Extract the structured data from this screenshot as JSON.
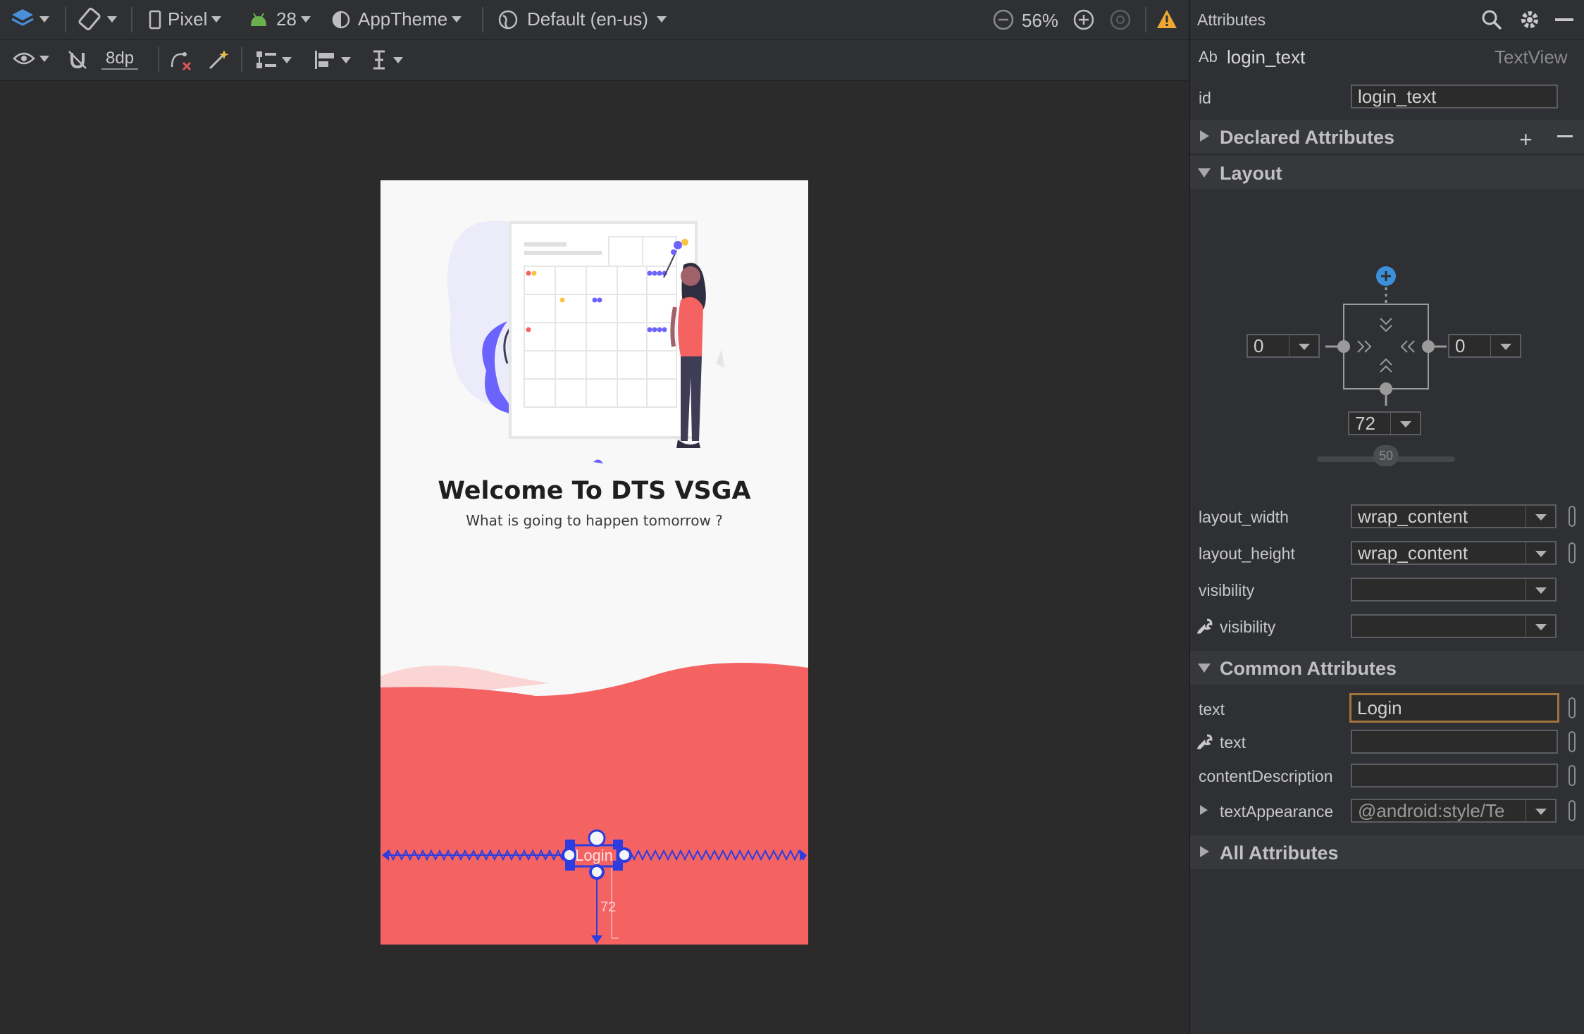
{
  "toolbar": {
    "device": "Pixel",
    "api_level": "28",
    "theme": "AppTheme",
    "locale": "Default (en-us)",
    "zoom": "56%",
    "margin_default": "8dp"
  },
  "phone": {
    "title": "Welcome To DTS VSGA",
    "subtitle": "What is going to happen tomorrow ?",
    "selected_view_text": "Login",
    "bottom_margin_label": "72"
  },
  "panel": {
    "header_title": "Attributes",
    "component_prefix": "Ab",
    "component_name": "login_text",
    "component_type": "TextView",
    "id_label": "id",
    "id_value": "login_text",
    "sections": {
      "declared": "Declared Attributes",
      "layout": "Layout",
      "common": "Common Attributes",
      "all": "All Attributes"
    },
    "constraint": {
      "left_margin": "0",
      "right_margin": "0",
      "bottom_margin": "72",
      "bias": "50"
    },
    "layout_rows": [
      {
        "label": "layout_width",
        "value": "wrap_content"
      },
      {
        "label": "layout_height",
        "value": "wrap_content"
      },
      {
        "label": "visibility",
        "value": ""
      },
      {
        "label": "visibility",
        "value": ""
      }
    ],
    "common_rows": [
      {
        "label": "text",
        "value": "Login"
      },
      {
        "label": "text",
        "value": ""
      },
      {
        "label": "contentDescription",
        "value": ""
      },
      {
        "label": "textAppearance",
        "value": "@android:style/Te"
      }
    ]
  },
  "colors": {
    "accent_blue": "#3b4cf5",
    "wave_red": "#f56262",
    "panel_bg": "#2e3033",
    "text_field_focus": "#a0743a"
  }
}
